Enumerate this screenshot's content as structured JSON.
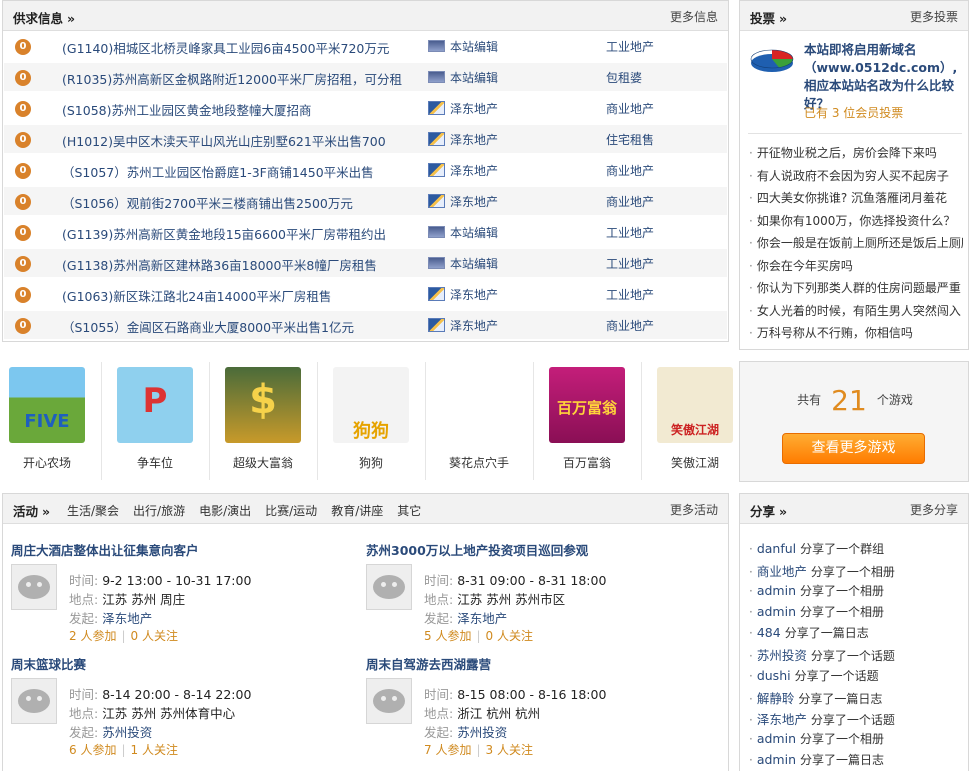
{
  "supply": {
    "title": "供求信息",
    "more": "更多信息",
    "rows": [
      {
        "count": "0",
        "title": "(G1140)相城区北桥灵峰家具工业园6亩4500平米720万元",
        "source": "本站编辑",
        "source_icon": "site-editor-icon",
        "category": "工业地产"
      },
      {
        "count": "0",
        "title": "(R1035)苏州高新区金枫路附近12000平米厂房招租，可分租",
        "source": "本站编辑",
        "source_icon": "site-editor-icon",
        "category": "包租婆"
      },
      {
        "count": "0",
        "title": "(S1058)苏州工业园区黄金地段整幢大厦招商",
        "source": "泽东地产",
        "source_icon": "agency-icon",
        "category": "商业地产"
      },
      {
        "count": "0",
        "title": "(H1012)吴中区木渎天平山风光山庄别墅621平米出售700",
        "source": "泽东地产",
        "source_icon": "agency-icon",
        "category": "住宅租售"
      },
      {
        "count": "0",
        "title": "（S1057）苏州工业园区怡爵庭1-3F商铺1450平米出售",
        "source": "泽东地产",
        "source_icon": "agency-icon",
        "category": "商业地产"
      },
      {
        "count": "0",
        "title": "（S1056）观前街2700平米三楼商铺出售2500万元",
        "source": "泽东地产",
        "source_icon": "agency-icon",
        "category": "商业地产"
      },
      {
        "count": "0",
        "title": "(G1139)苏州高新区黄金地段15亩6600平米厂房带租约出",
        "source": "本站编辑",
        "source_icon": "site-editor-icon",
        "category": "工业地产"
      },
      {
        "count": "0",
        "title": "(G1138)苏州高新区建林路36亩18000平米8幢厂房租售",
        "source": "本站编辑",
        "source_icon": "site-editor-icon",
        "category": "工业地产"
      },
      {
        "count": "0",
        "title": "(G1063)新区珠江路北24亩14000平米厂房租售",
        "source": "泽东地产",
        "source_icon": "agency-icon",
        "category": "工业地产"
      },
      {
        "count": "0",
        "title": "（S1055）金阊区石路商业大厦8000平米出售1亿元",
        "source": "泽东地产",
        "source_icon": "agency-icon",
        "category": "商业地产"
      }
    ]
  },
  "vote": {
    "title": "投票",
    "more": "更多投票",
    "icon": "pie-chart-icon",
    "headline": "本站即将启用新域名（www.0512dc.com）,相应本站站名改为什么比较好？",
    "count_text": "已有 3 位会员投票",
    "items": [
      "开征物业税之后，房价会降下来吗",
      "有人说政府不会因为穷人买不起房子",
      "四大美女你挑谁? 沉鱼落雁闭月羞花",
      "如果你有1000万，你选择投资什么？",
      "你会一般是在饭前上厕所还是饭后上厕所",
      "你会在今年买房吗",
      "你认为下列那类人群的住房问题最严重",
      "女人光着的时候，有陌生男人突然闯入",
      "万科号称从不行贿，你相信吗"
    ]
  },
  "games": [
    {
      "label": "开心农场",
      "icon": "five-minutes-farm-icon",
      "img_text": "FIVE"
    },
    {
      "label": "争车位",
      "icon": "parking-sign-icon",
      "img_text": "P"
    },
    {
      "label": "超级大富翁",
      "icon": "dollar-tycoon-icon",
      "img_text": "$"
    },
    {
      "label": "狗狗",
      "icon": "husky-dog-icon",
      "img_text": "狗狗"
    },
    {
      "label": "葵花点穴手",
      "icon": "ninja-hat-icon",
      "img_text": ""
    },
    {
      "label": "百万富翁",
      "icon": "millionaire-icon",
      "img_text": "百万富翁"
    },
    {
      "label": "笑傲江湖",
      "icon": "cleaver-icon",
      "img_text": "笑傲江湖"
    }
  ],
  "game_count": {
    "prefix": "共有",
    "number": "21",
    "suffix": "个游戏",
    "button": "查看更多游戏"
  },
  "activity": {
    "title": "活动",
    "more": "更多活动",
    "tabs": [
      "生活/聚会",
      "出行/旅游",
      "电影/演出",
      "比赛/运动",
      "教育/讲座",
      "其它"
    ],
    "time_key": "时间:",
    "place_key": "地点:",
    "host_key": "发起:",
    "items": [
      {
        "title": "周庄大酒店整体出让征集意向客户",
        "time": "9-2 13:00 - 10-31 17:00",
        "place": "江苏  苏州  周庄",
        "host": "泽东地产",
        "join": "2 人参加",
        "follow": "0 人关注"
      },
      {
        "title": "苏州3000万以上地产投资项目巡回参观",
        "time": "8-31 09:00 - 8-31 18:00",
        "place": "江苏  苏州  苏州市区",
        "host": "泽东地产",
        "join": "5 人参加",
        "follow": "0 人关注"
      },
      {
        "title": "周末篮球比赛",
        "time": "8-14 20:00 - 8-14 22:00",
        "place": "江苏  苏州  苏州体育中心",
        "host": "苏州投资",
        "join": "6 人参加",
        "follow": "1 人关注"
      },
      {
        "title": "周末自驾游去西湖露营",
        "time": "8-15 08:00 - 8-16 18:00",
        "place": "浙江  杭州  杭州",
        "host": "苏州投资",
        "join": "7 人参加",
        "follow": "3 人关注"
      }
    ]
  },
  "share": {
    "title": "分享",
    "more": "更多分享",
    "items": [
      {
        "user": "danful",
        "action": "分享了一个群组"
      },
      {
        "user": "商业地产",
        "action": "分享了一个相册"
      },
      {
        "user": "admin",
        "action": "分享了一个相册"
      },
      {
        "user": "admin",
        "action": "分享了一个相册"
      },
      {
        "user": "484",
        "action": "分享了一篇日志"
      },
      {
        "user": "苏州投资",
        "action": "分享了一个话题"
      },
      {
        "user": "dushi",
        "action": "分享了一个话题"
      },
      {
        "user": "解静聆",
        "action": "分享了一篇日志"
      },
      {
        "user": "泽东地产",
        "action": "分享了一个话题"
      },
      {
        "user": "admin",
        "action": "分享了一个相册"
      },
      {
        "user": "admin",
        "action": "分享了一篇日志"
      }
    ]
  },
  "colors": {
    "link": "#2a4a7a",
    "accent_orange": "#e08b1f",
    "badge": "#d9822b"
  }
}
